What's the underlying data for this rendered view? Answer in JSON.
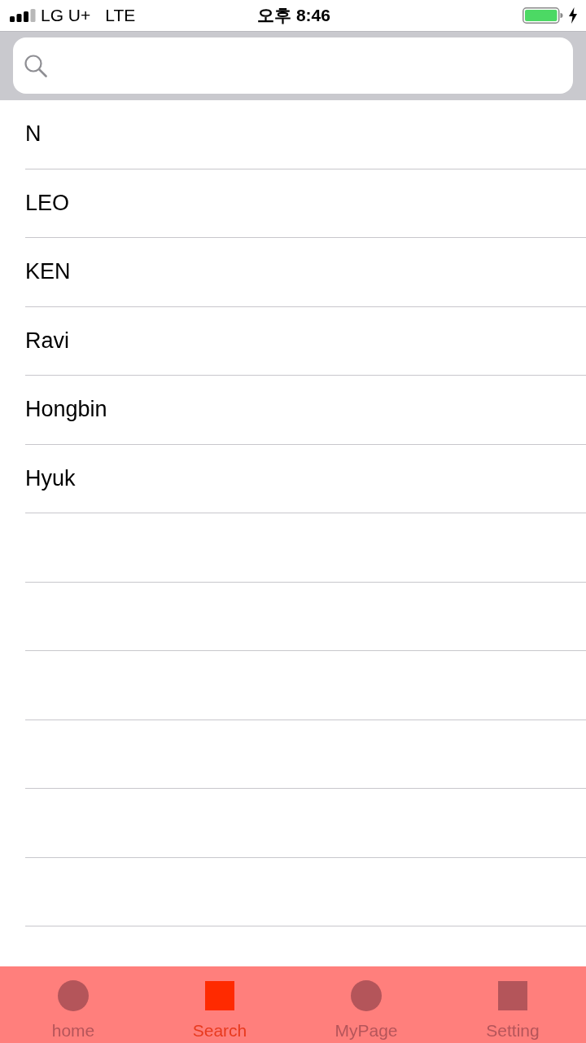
{
  "status_bar": {
    "carrier": "LG U+",
    "network": "LTE",
    "time": "오후 8:46"
  },
  "list": {
    "rows": [
      {
        "kind": "name",
        "label": "N"
      },
      {
        "kind": "name",
        "label": "LEO"
      },
      {
        "kind": "name",
        "label": "KEN"
      },
      {
        "kind": "name",
        "label": "Ravi"
      },
      {
        "kind": "name",
        "label": "Hongbin"
      },
      {
        "kind": "name",
        "label": "Hyuk"
      },
      {
        "kind": "empty"
      },
      {
        "kind": "empty"
      },
      {
        "kind": "empty"
      },
      {
        "kind": "empty"
      },
      {
        "kind": "empty"
      },
      {
        "kind": "empty"
      },
      {
        "kind": "empty"
      }
    ]
  },
  "tabs": [
    {
      "label": "home",
      "kind": "circle",
      "selected": false
    },
    {
      "label": "Search",
      "kind": "square",
      "selected": true
    },
    {
      "label": "MyPage",
      "kind": "circle",
      "selected": false
    },
    {
      "label": "Setting",
      "kind": "square",
      "selected": false
    }
  ]
}
